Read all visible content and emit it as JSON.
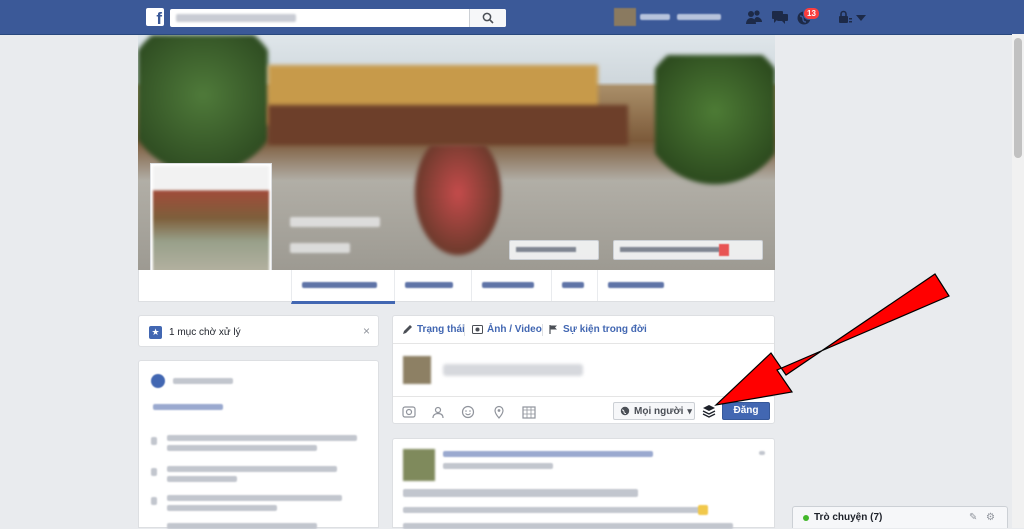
{
  "topbar": {
    "logo": "f",
    "notification_count": "13"
  },
  "pending": {
    "label": "1 mục chờ xử lý",
    "close": "×"
  },
  "composer": {
    "tabs": [
      {
        "label": "Trạng thái"
      },
      {
        "label": "Ảnh / Video"
      },
      {
        "label": "Sự kiện trong đời"
      }
    ],
    "audience": "Mọi người",
    "audience_caret": "▾",
    "post_button": "Đăng"
  },
  "chat": {
    "label": "Trò chuyện (7)"
  },
  "colors": {
    "brand": "#3b5998",
    "button": "#4267b2",
    "arrow": "#ff0000",
    "online": "#42b72a",
    "badge": "#fa3e3e"
  }
}
